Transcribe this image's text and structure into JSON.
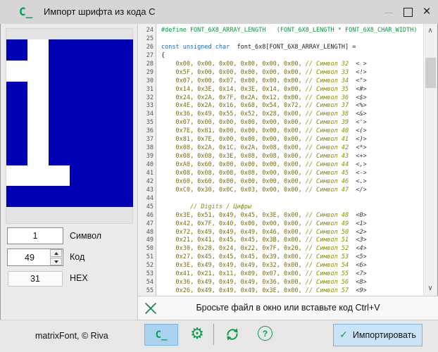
{
  "window": {
    "icon": "C_",
    "title": "Импорт шрифта из кода C",
    "minimize_glyph": "—",
    "close_glyph": "×"
  },
  "colors": {
    "accent_green": "#00a24e",
    "glyph_off_blue": "#0000b4",
    "glyph_on_white": "#ffffff",
    "button_blue_bg": "#a9d3f1",
    "keyword_blue": "#1668c9",
    "comment_olive": "#8f8f00"
  },
  "preview": {
    "on_color": "#ffffff",
    "off_color": "#0000b4",
    "grid": [
      [
        0,
        1,
        0,
        0,
        0,
        0
      ],
      [
        1,
        1,
        0,
        0,
        0,
        0
      ],
      [
        0,
        1,
        0,
        0,
        0,
        0
      ],
      [
        0,
        1,
        0,
        0,
        0,
        0
      ],
      [
        0,
        1,
        0,
        0,
        0,
        0
      ],
      [
        0,
        1,
        0,
        0,
        0,
        0
      ],
      [
        1,
        1,
        1,
        0,
        0,
        0
      ],
      [
        0,
        0,
        0,
        0,
        0,
        0
      ]
    ]
  },
  "fields": {
    "symbol": {
      "value": "1",
      "label": "Символ"
    },
    "code": {
      "value": "49",
      "label": "Код"
    },
    "hex": {
      "value": "31",
      "label": "HEX"
    }
  },
  "scrollbar": {
    "up_glyph": "∧",
    "down_glyph": "∨"
  },
  "editor": {
    "lines": [
      {
        "n": "24",
        "s": [
          [
            "pp",
            "#define FONT_6X8_ARRAY_LENGTH   (FONT_6X8_LENGTH * FONT_6X8_CHAR_WIDTH)"
          ]
        ]
      },
      {
        "n": "25",
        "s": []
      },
      {
        "n": "26",
        "s": [
          [
            "kw",
            "const unsigned char"
          ],
          [
            "plain",
            "  font_6x8[FONT_6X8_ARRAY_LENGTH] ="
          ]
        ]
      },
      {
        "n": "27",
        "s": [
          [
            "plain",
            "{"
          ]
        ]
      },
      {
        "n": "28",
        "s": [
          [
            "val",
            "    0x00, 0x00, 0x00, 0x00, 0x00, 0x00, "
          ],
          [
            "cmt",
            "// Символ 32  "
          ],
          [
            "chr",
            "< >"
          ]
        ]
      },
      {
        "n": "29",
        "s": [
          [
            "val",
            "    0x5F, 0x00, 0x00, 0x00, 0x00, 0x00, "
          ],
          [
            "cmt",
            "// Символ 33  "
          ],
          [
            "chr",
            "<!>"
          ]
        ]
      },
      {
        "n": "30",
        "s": [
          [
            "val",
            "    0x07, 0x00, 0x07, 0x00, 0x00, 0x00, "
          ],
          [
            "cmt",
            "// Символ 34  "
          ],
          [
            "chr",
            "<\">"
          ]
        ]
      },
      {
        "n": "31",
        "s": [
          [
            "val",
            "    0x14, 0x3E, 0x14, 0x3E, 0x14, 0x00, "
          ],
          [
            "cmt",
            "// Символ 35  "
          ],
          [
            "chr",
            "<#>"
          ]
        ]
      },
      {
        "n": "32",
        "s": [
          [
            "val",
            "    0x24, 0x2A, 0x7F, 0x2A, 0x12, 0x00, "
          ],
          [
            "cmt",
            "// Символ 36  "
          ],
          [
            "chr",
            "<$>"
          ]
        ]
      },
      {
        "n": "33",
        "s": [
          [
            "val",
            "    0x4E, 0x2A, 0x16, 0x68, 0x54, 0x72, "
          ],
          [
            "cmt",
            "// Символ 37  "
          ],
          [
            "chr",
            "<%>"
          ]
        ]
      },
      {
        "n": "34",
        "s": [
          [
            "val",
            "    0x36, 0x49, 0x55, 0x52, 0x28, 0x00, "
          ],
          [
            "cmt",
            "// Символ 38  "
          ],
          [
            "chr",
            "<&>"
          ]
        ]
      },
      {
        "n": "35",
        "s": [
          [
            "val",
            "    0x07, 0x00, 0x00, 0x00, 0x00, 0x00, "
          ],
          [
            "cmt",
            "// Символ 39  "
          ],
          [
            "chr",
            "<'>"
          ]
        ]
      },
      {
        "n": "36",
        "s": [
          [
            "val",
            "    0x7E, 0x81, 0x00, 0x00, 0x00, 0x00, "
          ],
          [
            "cmt",
            "// Символ 40  "
          ],
          [
            "chr",
            "<(>"
          ]
        ]
      },
      {
        "n": "37",
        "s": [
          [
            "val",
            "    0x81, 0x7E, 0x00, 0x00, 0x00, 0x00, "
          ],
          [
            "cmt",
            "// Символ 41  "
          ],
          [
            "chr",
            "<)>"
          ]
        ]
      },
      {
        "n": "38",
        "s": [
          [
            "val",
            "    0x08, 0x2A, 0x1C, 0x2A, 0x08, 0x00, "
          ],
          [
            "cmt",
            "// Символ 42  "
          ],
          [
            "chr",
            "<*>"
          ]
        ]
      },
      {
        "n": "39",
        "s": [
          [
            "val",
            "    0x08, 0x08, 0x3E, 0x08, 0x08, 0x00, "
          ],
          [
            "cmt",
            "// Символ 43  "
          ],
          [
            "chr",
            "<+>"
          ]
        ]
      },
      {
        "n": "40",
        "s": [
          [
            "val",
            "    0xA0, 0x60, 0x00, 0x00, 0x00, 0x00, "
          ],
          [
            "cmt",
            "// Символ 44  "
          ],
          [
            "chr",
            "<,>"
          ]
        ]
      },
      {
        "n": "41",
        "s": [
          [
            "val",
            "    0x08, 0x08, 0x08, 0x08, 0x00, 0x00, "
          ],
          [
            "cmt",
            "// Символ 45  "
          ],
          [
            "chr",
            "<->"
          ]
        ]
      },
      {
        "n": "42",
        "s": [
          [
            "val",
            "    0x60, 0x60, 0x00, 0x00, 0x00, 0x00, "
          ],
          [
            "cmt",
            "// Символ 46  "
          ],
          [
            "chr",
            "<.>"
          ]
        ]
      },
      {
        "n": "43",
        "s": [
          [
            "val",
            "    0xC0, 0x30, 0x0C, 0x03, 0x00, 0x00, "
          ],
          [
            "cmt",
            "// Символ 47  "
          ],
          [
            "chr",
            "</>"
          ]
        ]
      },
      {
        "n": "44",
        "s": []
      },
      {
        "n": "45",
        "s": [
          [
            "cmt",
            "        // Digits / Цифры"
          ]
        ]
      },
      {
        "n": "46",
        "s": [
          [
            "val",
            "    0x3E, 0x51, 0x49, 0x45, 0x3E, 0x00, "
          ],
          [
            "cmt",
            "// Символ 48  "
          ],
          [
            "chr",
            "<0>"
          ]
        ]
      },
      {
        "n": "47",
        "s": [
          [
            "val",
            "    0x42, 0x7F, 0x40, 0x00, 0x00, 0x00, "
          ],
          [
            "cmt",
            "// Символ 49  "
          ],
          [
            "chr",
            "<1>"
          ]
        ]
      },
      {
        "n": "48",
        "s": [
          [
            "val",
            "    0x72, 0x49, 0x49, 0x49, 0x46, 0x00, "
          ],
          [
            "cmt",
            "// Символ 50  "
          ],
          [
            "chr",
            "<2>"
          ]
        ]
      },
      {
        "n": "49",
        "s": [
          [
            "val",
            "    0x21, 0x41, 0x45, 0x45, 0x3B, 0x00, "
          ],
          [
            "cmt",
            "// Символ 51  "
          ],
          [
            "chr",
            "<3>"
          ]
        ]
      },
      {
        "n": "50",
        "s": [
          [
            "val",
            "    0x30, 0x28, 0x24, 0x22, 0x7F, 0x20, "
          ],
          [
            "cmt",
            "// Символ 52  "
          ],
          [
            "chr",
            "<4>"
          ]
        ]
      },
      {
        "n": "51",
        "s": [
          [
            "val",
            "    0x27, 0x45, 0x45, 0x45, 0x39, 0x00, "
          ],
          [
            "cmt",
            "// Символ 53  "
          ],
          [
            "chr",
            "<5>"
          ]
        ]
      },
      {
        "n": "52",
        "s": [
          [
            "val",
            "    0x3E, 0x49, 0x49, 0x49, 0x32, 0x00, "
          ],
          [
            "cmt",
            "// Символ 54  "
          ],
          [
            "chr",
            "<6>"
          ]
        ]
      },
      {
        "n": "53",
        "s": [
          [
            "val",
            "    0x41, 0x21, 0x11, 0x09, 0x07, 0x00, "
          ],
          [
            "cmt",
            "// Символ 55  "
          ],
          [
            "chr",
            "<7>"
          ]
        ]
      },
      {
        "n": "54",
        "s": [
          [
            "val",
            "    0x36, 0x49, 0x49, 0x49, 0x36, 0x00, "
          ],
          [
            "cmt",
            "// Символ 56  "
          ],
          [
            "chr",
            "<8>"
          ]
        ]
      },
      {
        "n": "55",
        "s": [
          [
            "val",
            "    0x26, 0x49, 0x49, 0x49, 0x3E, 0x00, "
          ],
          [
            "cmt",
            "// Символ 57  "
          ],
          [
            "chr",
            "<9>"
          ]
        ]
      }
    ]
  },
  "dropbar": {
    "text": "Бросьте файл в окно или вставьте код Ctrl+V"
  },
  "footer": {
    "credit": "matrixFont, © Riva",
    "c_label": "C_",
    "help_glyph": "?",
    "import_check": "✓",
    "import_label": "Импортировать"
  }
}
